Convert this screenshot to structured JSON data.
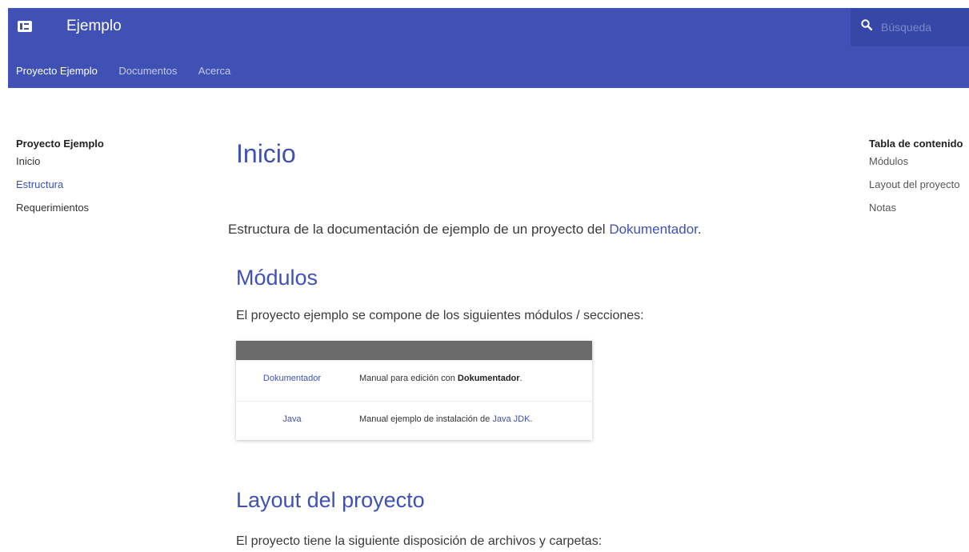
{
  "header": {
    "site_title": "Ejemplo",
    "search_placeholder": "Búsqueda",
    "tabs": [
      {
        "label": "Proyecto Ejemplo",
        "active": true
      },
      {
        "label": "Documentos",
        "active": false
      },
      {
        "label": "Acerca",
        "active": false
      }
    ],
    "icons": {
      "menu": "sidebar-toggle-icon",
      "search": "search-icon"
    },
    "colors": {
      "primary": "#3f51b5",
      "search_bg": "#3548a8"
    }
  },
  "sidebar": {
    "title": "Proyecto Ejemplo",
    "items": [
      {
        "label": "Inicio",
        "active": false
      },
      {
        "label": "Estructura",
        "active": true
      },
      {
        "label": "Requerimientos",
        "active": false
      }
    ]
  },
  "main": {
    "title": "Inicio",
    "intro_text": "Estructura de la documentación de ejemplo de un proyecto del",
    "intro_link": "Dokumentador",
    "intro_end": ".",
    "section_modules": {
      "heading": "Módulos",
      "text": "El proyecto ejemplo se compone de los siguientes módulos / secciones:"
    },
    "table": {
      "rows": [
        {
          "name": "Dokumentador",
          "desc_prefix": "Manual para edición con ",
          "desc_bold": "Dokumentador",
          "desc_suffix": "."
        },
        {
          "name": "Java",
          "desc_prefix": "Manual ejemplo de instalación de ",
          "desc_link": "Java JDK",
          "desc_suffix": "."
        }
      ]
    },
    "section_layout": {
      "heading": "Layout del proyecto",
      "text": "El proyecto tiene la siguiente disposición de archivos y carpetas:"
    }
  },
  "toc": {
    "title": "Tabla de contenido",
    "items": [
      "Módulos",
      "Layout del proyecto",
      "Notas"
    ]
  }
}
